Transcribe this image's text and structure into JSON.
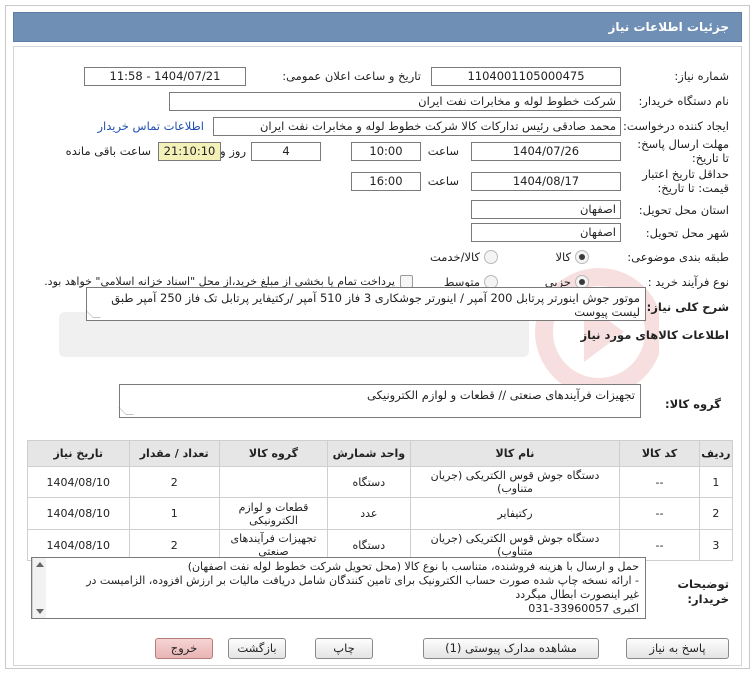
{
  "header": {
    "title": "جزئیات اطلاعات نیاز"
  },
  "fields": {
    "need_number_label": "شماره نیاز:",
    "need_number": "1104001105000475",
    "announce_label": "تاریخ و ساعت اعلان عمومی:",
    "announce_value": "1404/07/21 - 11:58",
    "buyer_org_label": "نام دستگاه خریدار:",
    "buyer_org": "شرکت خطوط لوله و مخابرات نفت ایران",
    "creator_label": "ایجاد کننده درخواست:",
    "creator": "محمد صادقی رئیس تدارکات کالا  شرکت خطوط لوله و مخابرات نفت ایران",
    "contact_link": "اطلاعات تماس خریدار",
    "reply_deadline_label": "مهلت ارسال پاسخ: تا تاریخ:",
    "reply_date": "1404/07/26",
    "time_label": "ساعت",
    "reply_time": "10:00",
    "days_value": "4",
    "days_label": "روز و",
    "remaining_time": "21:10:10",
    "remaining_label": "ساعت باقی مانده",
    "price_validity_label": "حداقل تاریخ اعتبار قیمت: تا تاریخ:",
    "price_date": "1404/08/17",
    "price_time_label": "ساعت",
    "price_time": "16:00",
    "province_label": "استان محل تحویل:",
    "province": "اصفهان",
    "city_label": "شهر محل تحویل:",
    "city": "اصفهان",
    "category_label": "طبقه بندی موضوعی:",
    "category_options": [
      "کالا",
      "کالا/خدمت"
    ],
    "category_selected": "کالا",
    "process_label": "نوع فرآیند خرید :",
    "process_options": [
      "جزیی",
      "متوسط"
    ],
    "process_selected": "جزیی",
    "payment_note": "پرداخت تمام یا بخشی از مبلغ خرید،از محل \"اسناد خزانه اسلامی\" خواهد بود.",
    "description_label": "شرح کلی نیاز:",
    "description": "موتور جوش اینورتر پرتابل  200 آمپر / اینورتر جوشکاری 3 فاز 510 آمپر /رکتیفایر پرتابل تک فاز 250 آمپر طبق لیست پیوست",
    "goods_info_label": "اطلاعات کالاهای مورد نیاز",
    "goods_group_label": "گروه کالا:",
    "goods_group": "تجهیزات فرآیندهای صنعتی // قطعات و لوازم الکترونیکی"
  },
  "table": {
    "headers": [
      "ردیف",
      "کد کالا",
      "نام کالا",
      "واحد شمارش",
      "گروه کالا",
      "تعداد / مقدار",
      "تاریخ نیاز"
    ],
    "rows": [
      {
        "row": "1",
        "code": "--",
        "name": "دستگاه جوش قوس الکتریکی (جریان متناوب)",
        "unit": "دستگاه",
        "group": "",
        "qty": "2",
        "date": "1404/08/10"
      },
      {
        "row": "2",
        "code": "--",
        "name": "رکتیفایر",
        "unit": "عدد",
        "group": "قطعات و لوازم الکترونیکی",
        "qty": "1",
        "date": "1404/08/10"
      },
      {
        "row": "3",
        "code": "--",
        "name": "دستگاه جوش قوس الکتریکی (جریان متناوب)",
        "unit": "دستگاه",
        "group": "تجهیزات فرآیندهای صنعتی",
        "qty": "2",
        "date": "1404/08/10"
      }
    ]
  },
  "notes": {
    "label": "توضیحات خریدار:",
    "lines": [
      "حمل و ارسال  با هزینه فروشنده، متناسب با نوع کالا (محل تحویل شرکت خطوط لوله نفت اصفهان)",
      "- ارائه نسخه چاپ شده صورت حساب الکترونیک برای تامین کنندگان شامل دریافت مالیات بر ارزش افزوده، الزامیست در",
      "غیر اینصورت ابطال میگردد",
      "اکبری 33960057-031"
    ]
  },
  "buttons": {
    "reply": "پاسخ به نیاز",
    "attachments": "مشاهده مدارک پیوستی (1)",
    "print": "چاپ",
    "back": "بازگشت",
    "exit": "خروج"
  },
  "colors": {
    "title_bar": "#6f8fb5",
    "remaining_bg": "#f3f0b8",
    "link": "#1f4fb5",
    "exit_button": "#e9b4b4"
  }
}
